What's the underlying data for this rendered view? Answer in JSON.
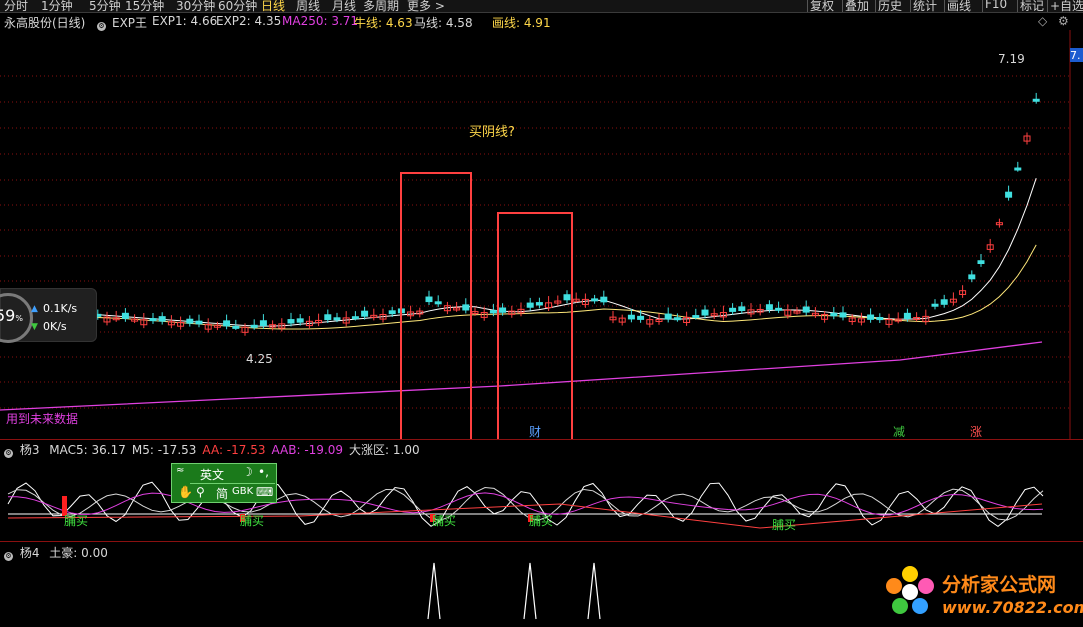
{
  "toolbar": {
    "periods": [
      "分时",
      "1分钟",
      "5分钟",
      "15分钟",
      "30分钟",
      "60分钟",
      "日线",
      "周线",
      "月线",
      "多周期",
      "更多 >"
    ],
    "active_period": "日线",
    "right_buttons": [
      "复权",
      "叠加",
      "历史",
      "统计",
      "画线",
      "F10",
      "标记",
      "+自选"
    ]
  },
  "main_legend": {
    "title": "永高股份(日线)",
    "items": [
      {
        "text": "EXP王",
        "color": "#d8d8d8"
      },
      {
        "text": "EXP1: 4.66",
        "color": "#d8d8d8"
      },
      {
        "text": "EXP2: 4.35",
        "color": "#d8d8d8"
      },
      {
        "text": "MA250: 3.71",
        "color": "#e040e0"
      },
      {
        "text": "牛线: 4.63",
        "color": "#ffd84a"
      },
      {
        "text": "马线: 4.58",
        "color": "#d8d8d8"
      },
      {
        "text": "画线: 4.91",
        "color": "#ffd84a"
      }
    ],
    "diamond": "◇",
    "settings": "⚙"
  },
  "chart_text": {
    "high_label": "7.19",
    "low_label": "4.25",
    "price_box": "7.",
    "annotation": "买阴线?",
    "future_warning": "用到未来数据",
    "marker_cai": "财",
    "marker_jian": "减",
    "marker_zhang": "涨"
  },
  "ind1": {
    "title": "杨3",
    "values": [
      {
        "text": "MAC5: 36.17",
        "color": "#d8d8d8"
      },
      {
        "text": "M5: -17.53",
        "color": "#d8d8d8"
      },
      {
        "text": "AA: -17.53",
        "color": "#ff4040"
      },
      {
        "text": "AAB: -19.09",
        "color": "#e040e0"
      },
      {
        "text": "大涨区: 1.00",
        "color": "#d8d8d8"
      }
    ],
    "buy_label": "脯买"
  },
  "ind2": {
    "title": "杨4",
    "values": [
      {
        "text": "土豪: 0.00",
        "color": "#d8d8d8"
      }
    ]
  },
  "ime": {
    "mode": "英文",
    "moon": "☽",
    "punct": "•,",
    "simplified": "简",
    "encoding": "GBK"
  },
  "speed": {
    "percent": "59",
    "unit": "%",
    "up": "0.1K/s",
    "down": "0K/s"
  },
  "logo": {
    "name": "分析家公式网",
    "url": "www.70822.com"
  },
  "chart_data": {
    "type": "candlestick",
    "title": "永高股份(日线)",
    "series": [
      {
        "name": "EXP1",
        "last": 4.66
      },
      {
        "name": "EXP2",
        "last": 4.35
      },
      {
        "name": "MA250",
        "last": 3.71
      },
      {
        "name": "牛线",
        "last": 4.63
      },
      {
        "name": "马线",
        "last": 4.58
      },
      {
        "name": "画线",
        "last": 4.91
      }
    ],
    "annotations": {
      "high": 7.19,
      "low": 4.25
    }
  }
}
